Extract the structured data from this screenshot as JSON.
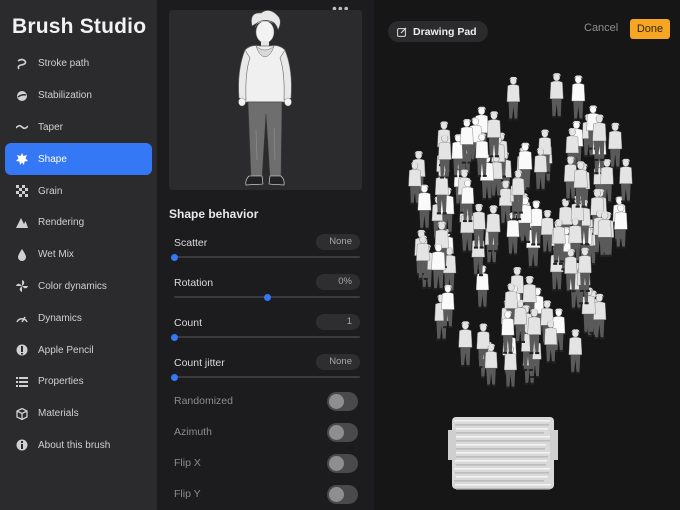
{
  "sidebar": {
    "title": "Brush Studio",
    "items": [
      {
        "label": "Stroke path",
        "icon": "stroke-path-icon"
      },
      {
        "label": "Stabilization",
        "icon": "stabilization-icon"
      },
      {
        "label": "Taper",
        "icon": "taper-icon"
      },
      {
        "label": "Shape",
        "icon": "shape-icon",
        "active": true
      },
      {
        "label": "Grain",
        "icon": "grain-icon"
      },
      {
        "label": "Rendering",
        "icon": "rendering-icon"
      },
      {
        "label": "Wet Mix",
        "icon": "wet-mix-icon"
      },
      {
        "label": "Color dynamics",
        "icon": "color-dynamics-icon"
      },
      {
        "label": "Dynamics",
        "icon": "dynamics-icon"
      },
      {
        "label": "Apple Pencil",
        "icon": "apple-pencil-icon"
      },
      {
        "label": "Properties",
        "icon": "properties-icon"
      },
      {
        "label": "Materials",
        "icon": "materials-icon"
      },
      {
        "label": "About this brush",
        "icon": "about-icon"
      }
    ]
  },
  "preview": {
    "more": "•••"
  },
  "shape_behavior": {
    "title": "Shape behavior",
    "sliders": [
      {
        "label": "Scatter",
        "value": "None",
        "level": 0.0
      },
      {
        "label": "Rotation",
        "value": "0%",
        "level": 0.5
      },
      {
        "label": "Count",
        "value": "1",
        "level": 0.0
      },
      {
        "label": "Count jitter",
        "value": "None",
        "level": 0.0
      }
    ],
    "toggles": [
      {
        "label": "Randomized",
        "on": false
      },
      {
        "label": "Azimuth",
        "on": false
      },
      {
        "label": "Flip X",
        "on": false
      },
      {
        "label": "Flip Y",
        "on": false
      }
    ]
  },
  "drawing_pad": {
    "title": "Drawing Pad",
    "cancel": "Cancel",
    "done": "Done"
  },
  "colors": {
    "accent": "#3478f6",
    "done": "#f5a623"
  }
}
